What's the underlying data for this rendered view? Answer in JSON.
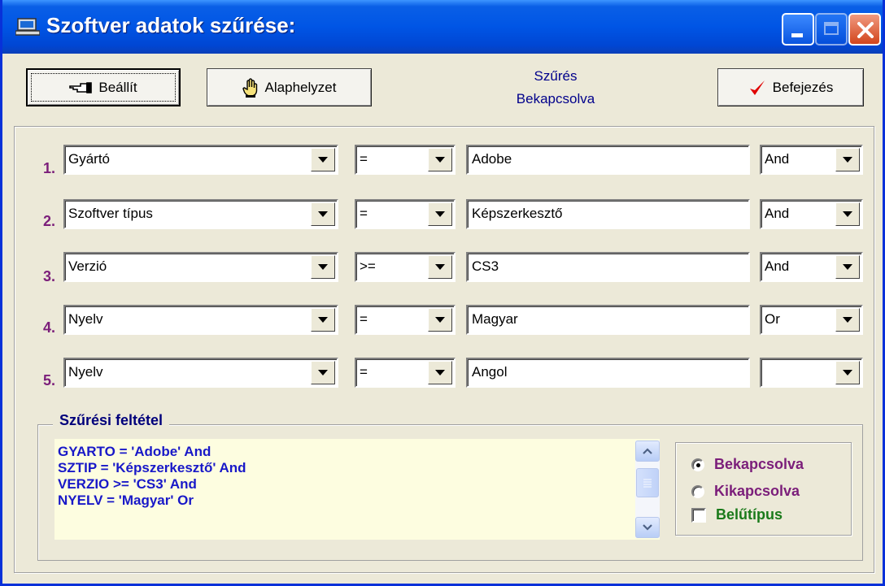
{
  "window": {
    "title": "Szoftver adatok szűrése:",
    "icon": "computer-icon"
  },
  "toolbar": {
    "set_label": "Beállít",
    "reset_label": "Alaphelyzet",
    "finish_label": "Befejezés",
    "status_line1": "Szűrés",
    "status_line2": "Bekapcsolva"
  },
  "rows": [
    {
      "num": "1.",
      "field": "Gyártó",
      "op": "=",
      "value": "Adobe",
      "logic": "And"
    },
    {
      "num": "2.",
      "field": "Szoftver típus",
      "op": "=",
      "value": "Képszerkesztő",
      "logic": "And"
    },
    {
      "num": "3.",
      "field": "Verzió",
      "op": ">=",
      "value": "CS3",
      "logic": "And"
    },
    {
      "num": "4.",
      "field": "Nyelv",
      "op": "=",
      "value": "Magyar",
      "logic": "Or"
    },
    {
      "num": "5.",
      "field": "Nyelv",
      "op": "=",
      "value": "Angol",
      "logic": ""
    }
  ],
  "condition": {
    "title": "Szűrési feltétel",
    "lines": [
      "GYARTO = 'Adobe' And",
      "SZTIP = 'Képszerkesztő' And",
      "VERZIO >= 'CS3' And",
      "NYELV = 'Magyar' Or"
    ]
  },
  "options": {
    "on_label": "Bekapcsolva",
    "off_label": "Kikapcsolva",
    "inline_label": "Belűtípus",
    "selected": "Bekapcsolva",
    "inline_checked": false
  },
  "colors": {
    "title_bar": "#0055e5",
    "row_number": "#7b1e7a",
    "condition_text": "#1818c8",
    "memo_background": "#fdfde0",
    "on_label": "#7b1e7a",
    "off_label": "#7b1e7a",
    "inline_label": "#1a7a1a",
    "finish_check": "#e00000"
  }
}
